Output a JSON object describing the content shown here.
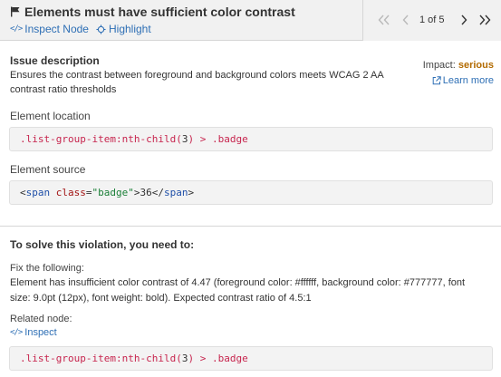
{
  "header": {
    "title": "Elements must have sufficient color contrast",
    "inspect_node": "Inspect Node",
    "highlight": "Highlight",
    "pager": {
      "count": "1 of 5"
    }
  },
  "issue": {
    "title": "Issue description",
    "description_line1": "Ensures the contrast between foreground and background colors meets WCAG 2 AA",
    "description_line2": "contrast ratio thresholds",
    "impact_label": "Impact:",
    "impact_value": "serious",
    "learn_more": "Learn more"
  },
  "element_location": {
    "label": "Element location",
    "selector_class": ".list-group-item",
    "selector_pseudo": ":nth-child(",
    "selector_num": "3",
    "selector_close": ")",
    "selector_combinator": " > ",
    "selector_child": ".badge"
  },
  "element_source": {
    "label": "Element source",
    "open_lt": "<",
    "tag": "span",
    "attr": "class",
    "eq": "=",
    "attr_value": "\"badge\"",
    "close_gt": ">",
    "content": "36",
    "end_lt": "</",
    "end_tag": "span",
    "end_gt": ">"
  },
  "solve": {
    "title": "To solve this violation, you need to:",
    "fix_label": "Fix the following:",
    "fix_line1": "Element has insufficient color contrast of 4.47 (foreground color: #ffffff, background color: #777777, font",
    "fix_line2": "size: 9.0pt (12px), font weight: bold). Expected contrast ratio of 4.5:1",
    "related_label": "Related node:",
    "inspect": "Inspect",
    "selector_class": ".list-group-item",
    "selector_pseudo": ":nth-child(",
    "selector_num": "3",
    "selector_close": ")",
    "selector_combinator": " > ",
    "selector_child": ".badge"
  },
  "colors": {
    "link": "#2e6fb5",
    "impact_serious": "#b36b00",
    "header_bg": "#f1f1f1",
    "code_bg": "#f3f3f3"
  },
  "icons": [
    "flag-icon",
    "code-icon",
    "highlight-icon",
    "first-page-icon",
    "prev-page-icon",
    "next-page-icon",
    "last-page-icon",
    "external-link-icon"
  ]
}
